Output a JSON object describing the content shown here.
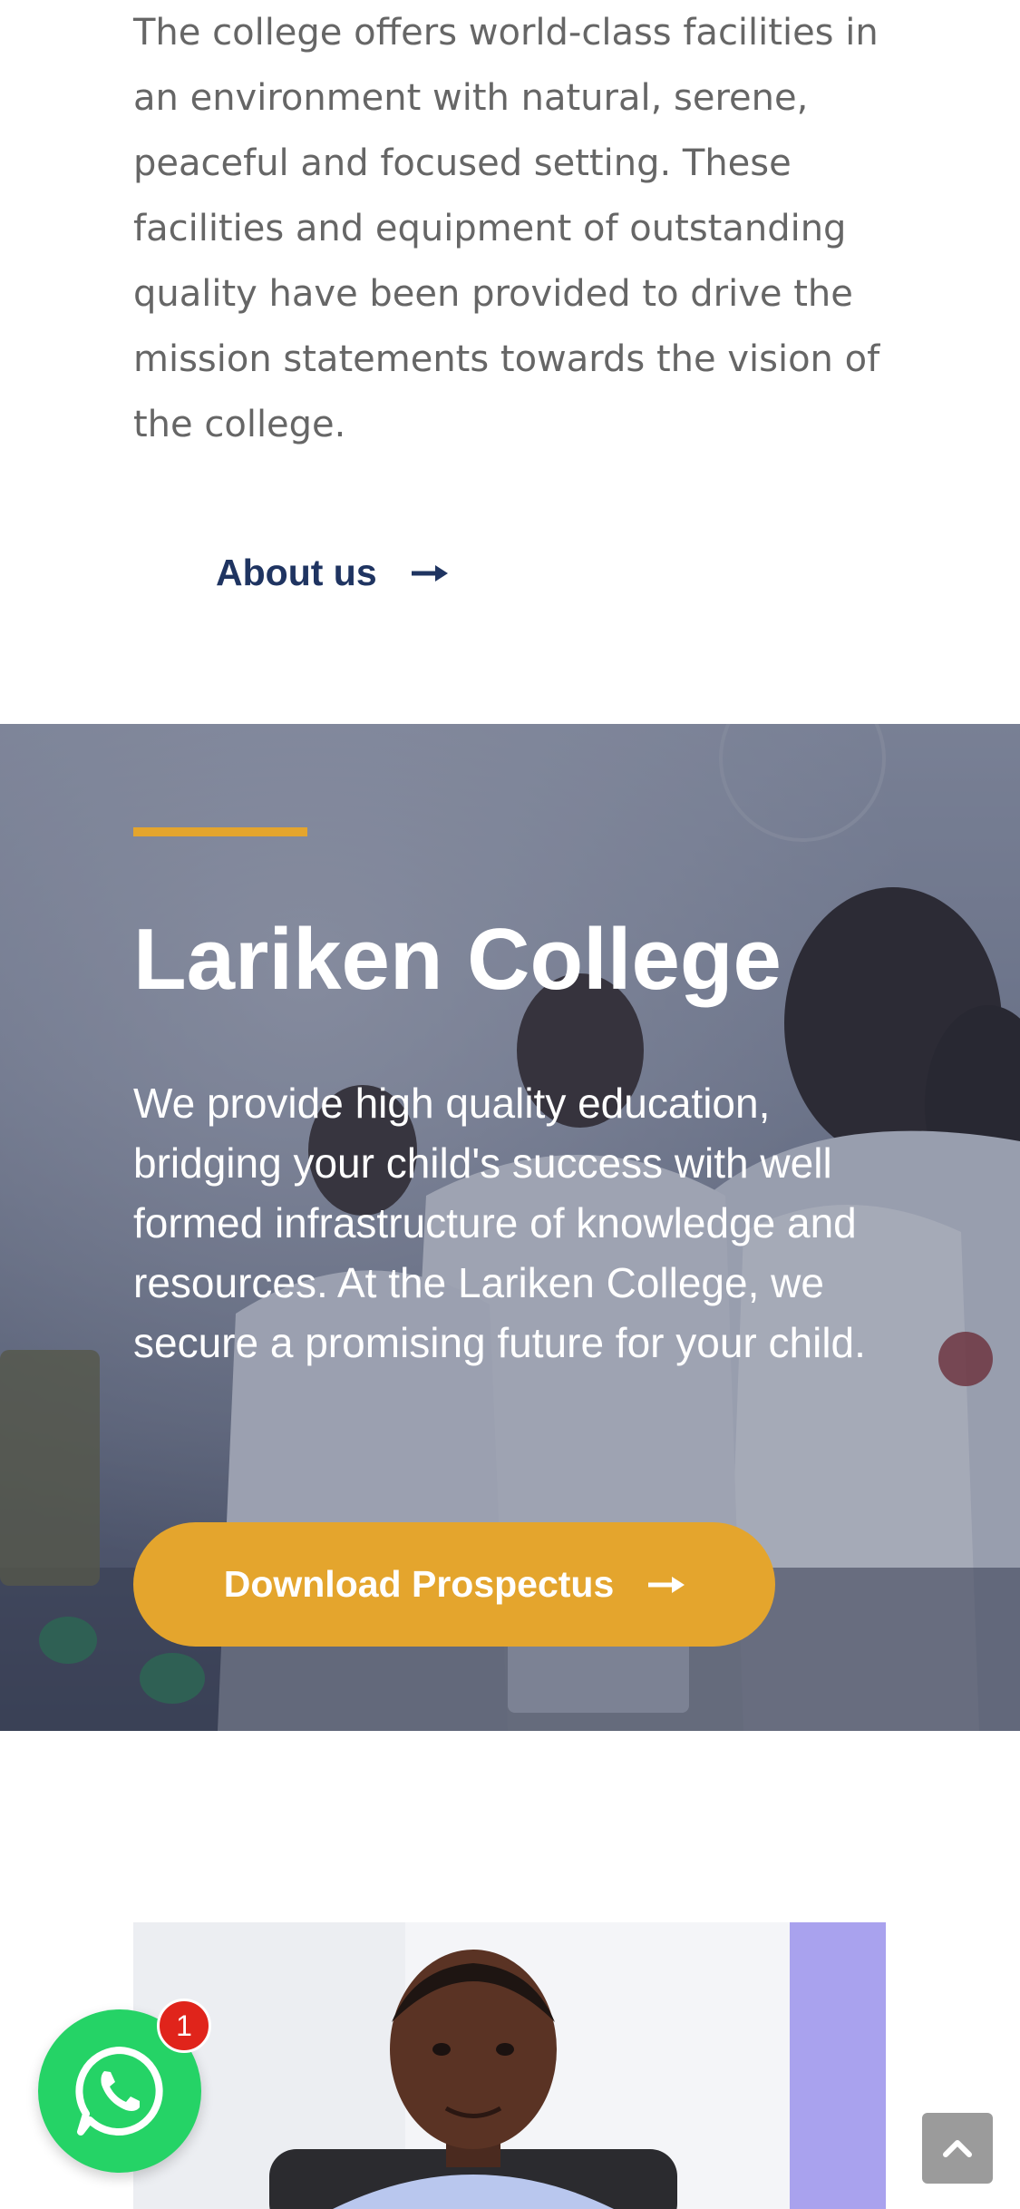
{
  "intro": {
    "paragraph": "The college offers world-class facilities in an environment with natural, serene, peaceful and focused setting. These facilities and equipment of outstanding quality have been provided to drive the mission statements towards the vision of the college.",
    "about_link_label": "About us",
    "about_icon": "arrow-right-icon"
  },
  "hero": {
    "title": "Lariken College",
    "description": "We provide high quality education, bridging your child's success with well formed infrastructure of knowledge and resources. At the Lariken College, we secure a promising future for your child.",
    "button_label": "Download Prospectus",
    "button_icon": "arrow-right-icon",
    "background": "students-in-laboratory-photo"
  },
  "staff": {
    "image": "staff-portrait-photo"
  },
  "widgets": {
    "whatsapp_icon": "whatsapp-icon",
    "whatsapp_badge_count": "1",
    "scroll_top_icon": "chevron-up-icon"
  },
  "colors": {
    "accent": "#e4a52d",
    "brand_navy": "#1f3461",
    "body_text": "#666666",
    "whatsapp_green": "#25d366",
    "badge_red": "#e0241b"
  }
}
